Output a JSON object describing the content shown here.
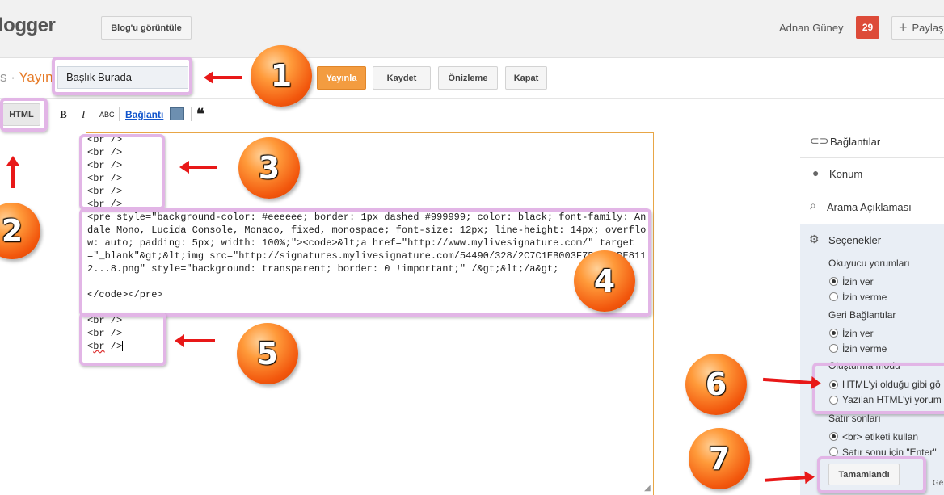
{
  "topbar": {
    "logo": "logger",
    "view_blog": "Blog'u görüntüle",
    "user_name": "Adnan Güney",
    "notification_count": "29",
    "share_label": "Paylaş"
  },
  "editor_header": {
    "breadcrumb_sep": "s ·",
    "breadcrumb_label": "Yayın",
    "title_value": "Başlık Burada",
    "publish": "Yayınla",
    "save": "Kaydet",
    "preview": "Önizleme",
    "close": "Kapat"
  },
  "toolbar": {
    "html_tab": "HTML",
    "bold": "B",
    "italic": "I",
    "spell": "ABC",
    "link": "Bağlantı",
    "quote": "❝"
  },
  "editor": {
    "br_block_1": "<br />\n<br />\n<br />\n<br />\n<br />\n<br />",
    "pre_block": "<pre style=\"background-color: #eeeeee; border: 1px dashed #999999; color: black; font-family: Andale Mono, Lucida Console, Monaco, fixed, monospace; font-size: 12px; line-height: 14px; overflow: auto; padding: 5px; width: 100%;\"><code>&lt;a href=\"http://www.mylivesignature.com/\" target=\"_blank\"&gt;&lt;img src=\"http://signatures.mylivesignature.com/54490/328/2C7C1EB003F7535FCDE8112...8.png\" style=\"background: transparent; border: 0 !important;\" /&gt;&lt;/a&gt;\n\n</code></pre>",
    "br_block_2a": "<br />\n<br />",
    "br_block_2b_prefix": "<",
    "br_block_2b_squig": "br",
    "br_block_2b_suffix": " />"
  },
  "sidebar": {
    "links": "Bağlantılar",
    "location": "Konum",
    "search_desc": "Arama Açıklaması",
    "options": "Seçenekler",
    "reader_comments": "Okuyucu yorumları",
    "allow": "İzin ver",
    "disallow": "İzin verme",
    "backlinks": "Geri Bağlantılar",
    "backlinks_allow": "İzin ver",
    "backlinks_disallow": "İzin verme",
    "compose_mode": "Oluşturma modu",
    "html_as_is": "HTML'yi olduğu gibi gö",
    "html_interpret": "Yazılan HTML'yi yorum",
    "line_breaks": "Satır sonları",
    "use_br": "<br> etiketi kullan",
    "enter_line": "Satır sonu için \"Enter\"",
    "done": "Tamamlandı",
    "ge": "Ge"
  },
  "annotations": [
    "1",
    "2",
    "3",
    "4",
    "5",
    "6",
    "7"
  ],
  "colors": {
    "publish": "#f39c40",
    "accent_orange": "#e67a26",
    "notif_red": "#dd4b39",
    "highlight": "#e2b5e6",
    "arrow_red": "#e81818"
  }
}
